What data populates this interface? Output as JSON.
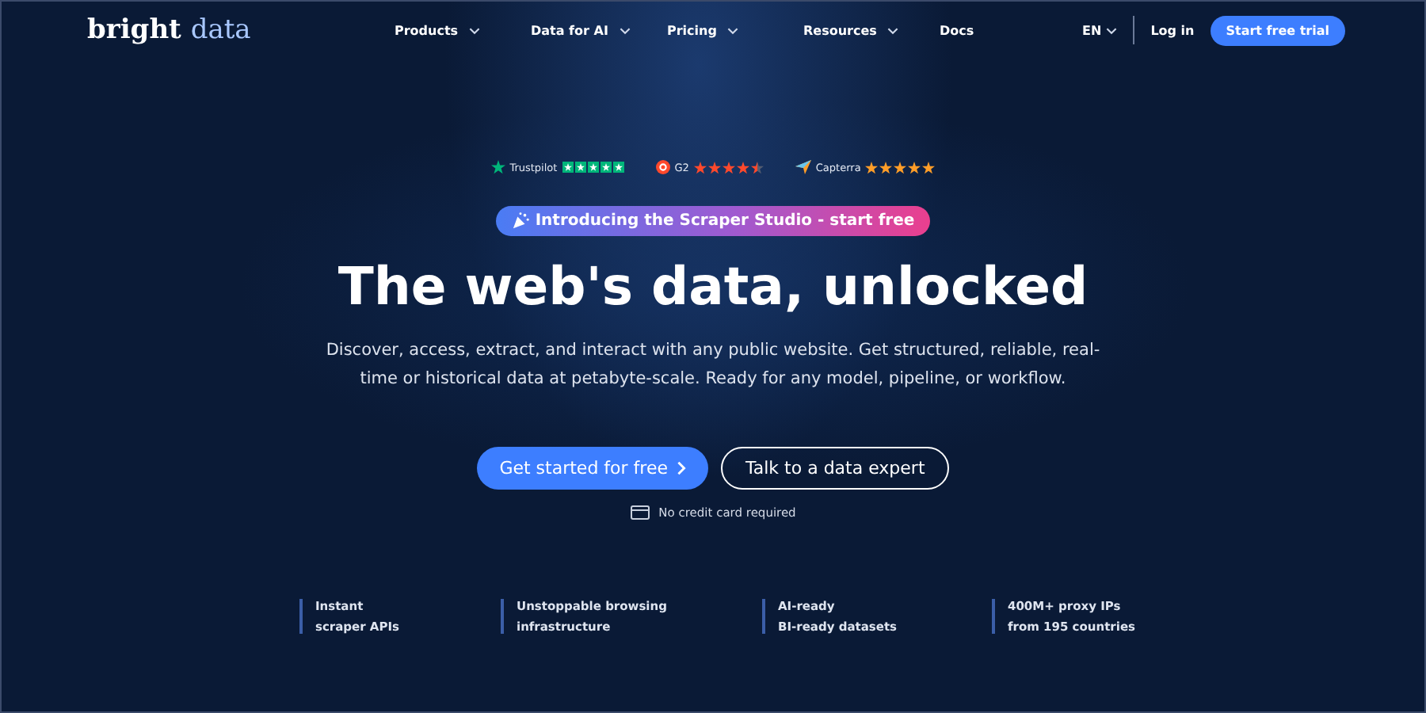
{
  "header": {
    "logo": {
      "part_1": "bright",
      "part_2": "data"
    },
    "nav": [
      {
        "label": "Products",
        "has_menu": true
      },
      {
        "label": "Data for AI",
        "has_menu": true
      },
      {
        "label": "Pricing",
        "has_menu": true
      },
      {
        "label": "Resources",
        "has_menu": true
      },
      {
        "label": "Docs",
        "has_menu": false
      }
    ],
    "language": "EN",
    "login": "Log in",
    "cta": "Start free trial"
  },
  "ratings": [
    {
      "kind": "trustpilot",
      "label": "Trustpilot",
      "stars": 5
    },
    {
      "kind": "g2",
      "label": "G2",
      "stars": 4.5
    },
    {
      "kind": "capterra",
      "label": "Capterra",
      "stars": 5
    }
  ],
  "announcement": "Introducing the Scraper Studio - start free",
  "headline": "The web's data, unlocked",
  "description": "Discover, access, extract, and interact with any public website. Get structured, reliable, real-time or historical data at petabyte-scale. Ready for any model, pipeline, or workflow.",
  "buttons": {
    "primary": "Get started for free",
    "secondary": "Talk to a data expert"
  },
  "note": "No credit card required",
  "features": [
    {
      "line_1": "Instant",
      "line_2": "scraper APIs"
    },
    {
      "line_1": "Unstoppable browsing",
      "line_2": "infrastructure"
    },
    {
      "line_1": "AI-ready",
      "line_2": "BI-ready datasets"
    },
    {
      "line_1": "400M+ proxy IPs",
      "line_2": "from 195 countries"
    }
  ]
}
